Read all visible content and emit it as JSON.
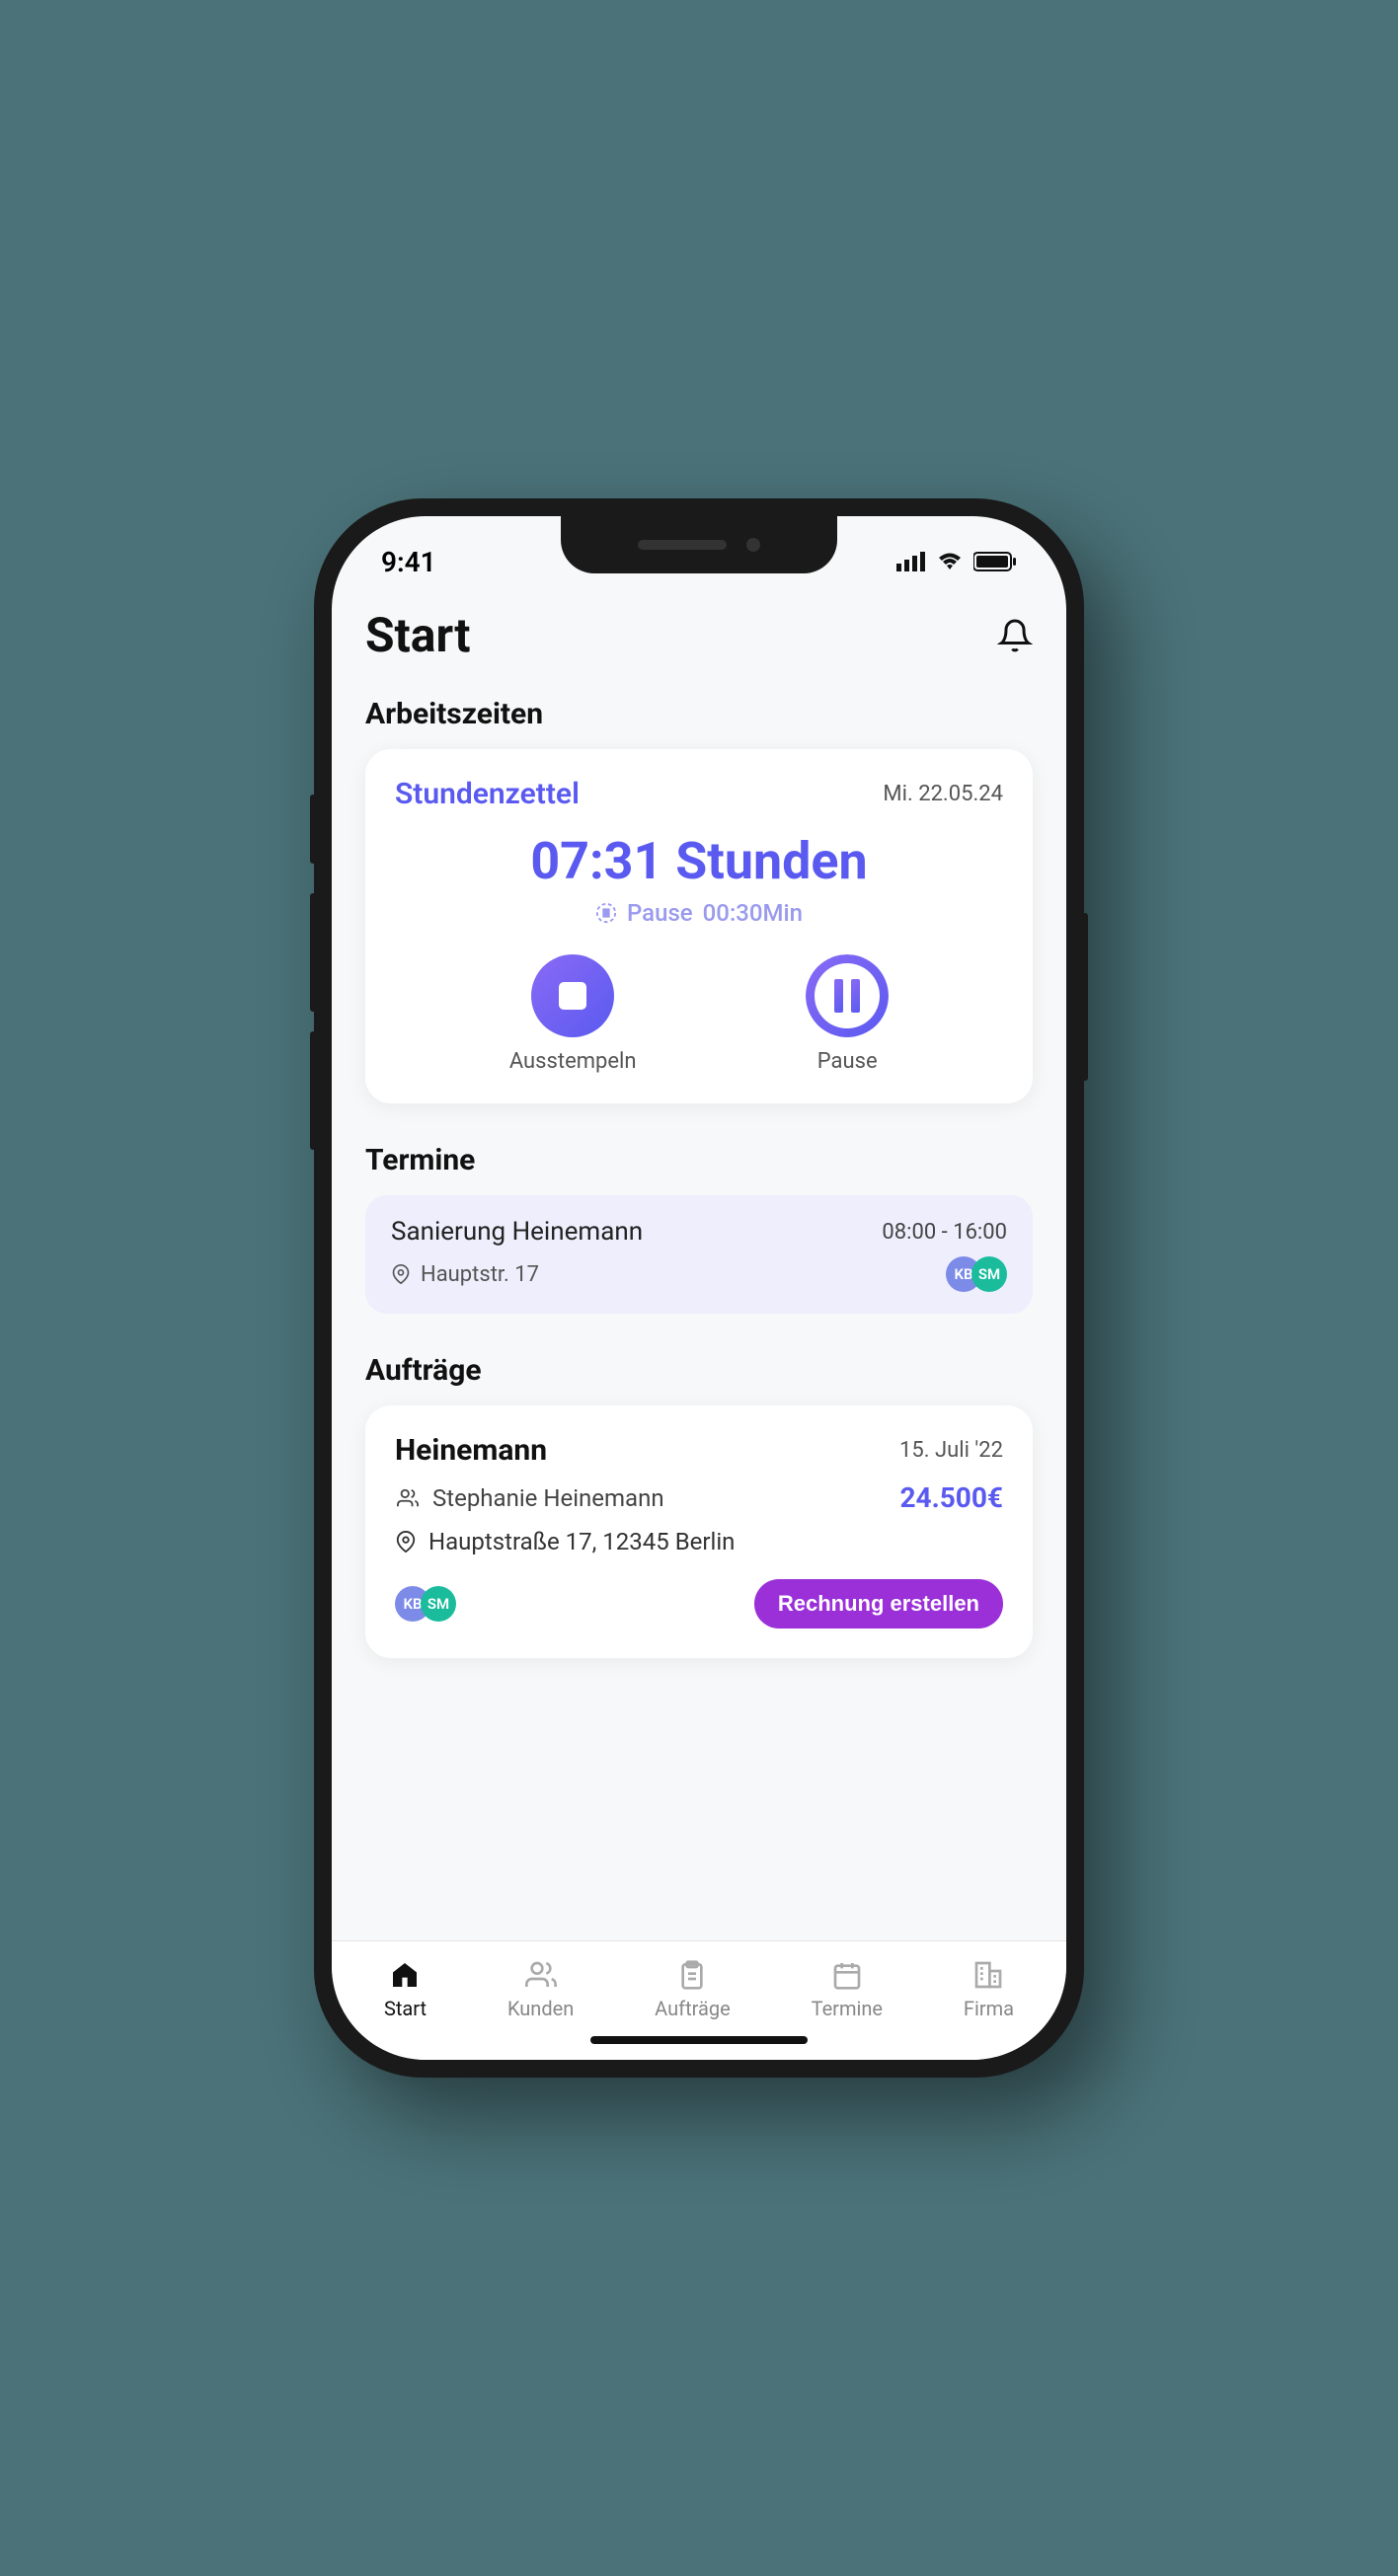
{
  "status_bar": {
    "time": "9:41"
  },
  "header": {
    "title": "Start"
  },
  "arbeitszeiten": {
    "section_title": "Arbeitszeiten",
    "link_label": "Stundenzettel",
    "date": "Mi. 22.05.24",
    "big_time": "07:31 Stunden",
    "pause_label": "Pause",
    "pause_time": "00:30Min",
    "stop_label": "Ausstempeln",
    "pause_btn_label": "Pause"
  },
  "termine": {
    "section_title": "Termine",
    "title": "Sanierung Heinemann",
    "time_range": "08:00 - 16:00",
    "address": "Hauptstr. 17",
    "avatars": [
      "KB",
      "SM"
    ]
  },
  "auftraege": {
    "section_title": "Aufträge",
    "title": "Heinemann",
    "date": "15. Juli '22",
    "person": "Stephanie Heinemann",
    "price": "24.500€",
    "address": "Hauptstraße 17, 12345 Berlin",
    "avatars": [
      "KB",
      "SM"
    ],
    "invoice_btn": "Rechnung erstellen"
  },
  "tabs": {
    "start": "Start",
    "kunden": "Kunden",
    "auftraege": "Aufträge",
    "termine": "Termine",
    "firma": "Firma"
  }
}
